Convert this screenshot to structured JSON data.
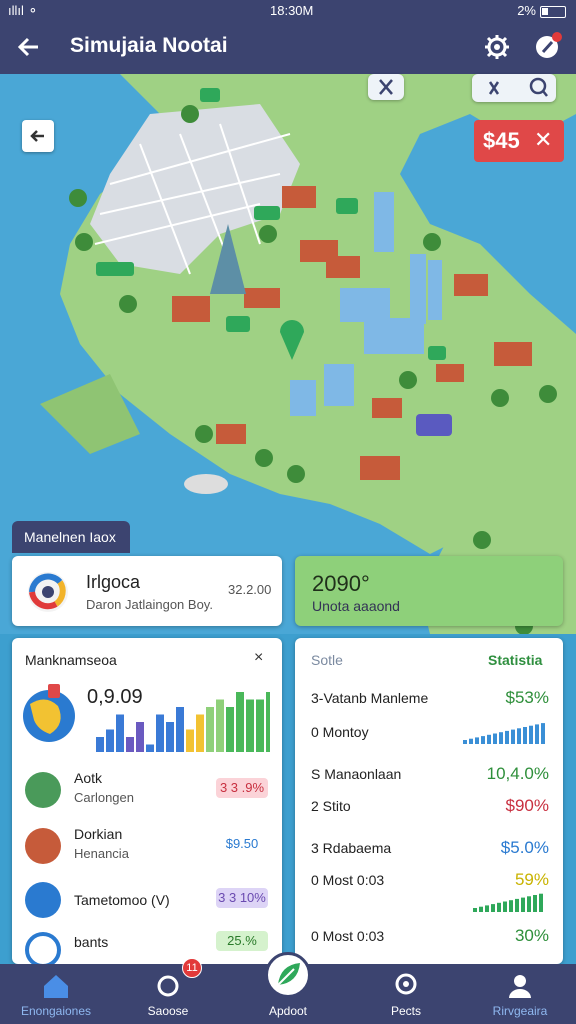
{
  "status": {
    "left": "ıllıl ⚬",
    "time": "18:30M",
    "battery": "2%"
  },
  "header": {
    "title": "Simujaia Nootai"
  },
  "map": {
    "money": "$45",
    "money_close": "✕",
    "panel_label": "Manelnen Iaox"
  },
  "card_left": {
    "title": "Irlgoca",
    "subtitle": "Daron Jatlaingon Boy.",
    "number": "32.2.00"
  },
  "card_right": {
    "value": "2090°",
    "subtitle": "Unota aaaond"
  },
  "card_main": {
    "header": "Manknamseoa",
    "close": "×",
    "big_value": "0,9.09",
    "bar_values": [
      2,
      3,
      5,
      2,
      4,
      1,
      5,
      4,
      6,
      3,
      5,
      6,
      7,
      6,
      8,
      7,
      7,
      8
    ],
    "rows": [
      {
        "name": "Aotk",
        "sub": "Carlongen",
        "value": "3 3 .9%",
        "color": "#fbd3d8",
        "text": "#c83040"
      },
      {
        "name": "Dorkian",
        "sub": "Henancia",
        "value": "$9.50",
        "color": "#ffffff",
        "text": "#2a7ad0"
      },
      {
        "name": "Tametomoo (V)",
        "sub": "",
        "value": "3 3 10%",
        "color": "#ddd4f6",
        "text": "#6a4ab0"
      },
      {
        "name": "bants",
        "sub": "",
        "value": "25.%",
        "color": "#d5f2cd",
        "text": "#2a7a2a"
      }
    ]
  },
  "card_stats": {
    "header_left": "Sotle",
    "header_right": "Statistia",
    "rows": [
      {
        "key": "3-Vatanb Manleme",
        "value": "$53%",
        "color": "#2e8f3a"
      },
      {
        "key": "0 Montoy",
        "value": "",
        "color": "#2a7ad0"
      },
      {
        "key": "S Manaonlaan",
        "value": "10,4.0%",
        "color": "#2e8f3a"
      },
      {
        "key": "2 Stito",
        "value": "$90%",
        "color": "#c83040"
      },
      {
        "key": "3 Rdabaema",
        "value": "$5.0%",
        "color": "#2a7ad0"
      },
      {
        "key": "0 Most 0:03",
        "value": "59%",
        "color": "#c9b300"
      },
      {
        "key": "0 Most 0:03",
        "value": "30%",
        "color": "#2e8f3a"
      }
    ]
  },
  "nav": {
    "items": [
      "Enongaiones",
      "Saoose",
      "Apdoot",
      "Pects",
      "Rirvgeaira"
    ],
    "badge": "11"
  }
}
